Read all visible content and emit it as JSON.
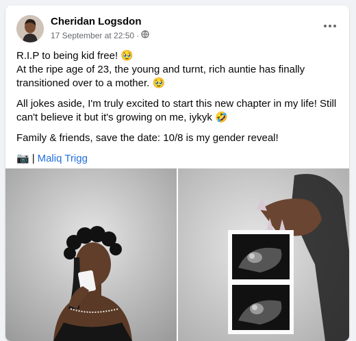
{
  "post": {
    "author": "Cheridan Logsdon",
    "timestamp": "17 September at 22:50",
    "separator": "·",
    "audience_icon": "globe-icon",
    "more_icon": "more-options-icon",
    "lines": [
      "R.I.P to being kid free! 🥹",
      "At the ripe age of 23, the young and turnt, rich auntie has finally transitioned over to a mother. 🥹",
      "All jokes aside, I'm truly excited to start this new chapter in my life! Still can't believe it but it's growing on me, iykyk 🤣",
      "Family & friends, save the date: 10/8 is my gender reveal!"
    ],
    "credit_icon": "📷",
    "credit_separator": "|",
    "credit_name": "Maliq Trigg"
  },
  "colors": {
    "background": "#f0f2f5",
    "card": "#ffffff",
    "text": "#050505",
    "secondary": "#65676b",
    "link": "#216fdb"
  },
  "photos": [
    {
      "name": "photo-woman-with-floral-crown",
      "icon": "photo-icon"
    },
    {
      "name": "photo-ultrasound-held-up",
      "icon": "photo-icon"
    }
  ]
}
